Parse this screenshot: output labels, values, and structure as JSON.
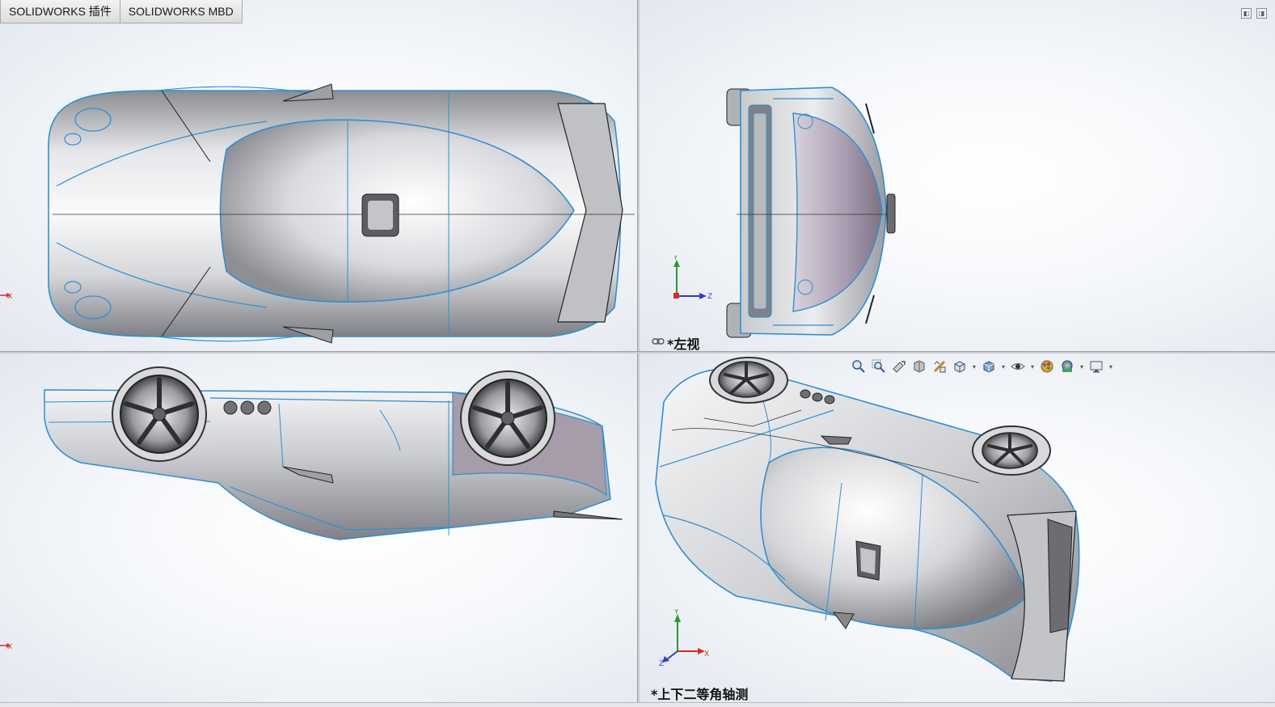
{
  "tabs": [
    {
      "label": "SOLIDWORKS 插件"
    },
    {
      "label": "SOLIDWORKS MBD"
    }
  ],
  "viewports": {
    "top_left": {
      "axis_x": "X"
    },
    "top_right": {
      "view_label": "*左视",
      "axis_y": "Y",
      "axis_z": "Z"
    },
    "bottom_left": {
      "axis_x": "X"
    },
    "bottom_right": {
      "view_label": "*上下二等角轴测",
      "axis_y": "Y",
      "axis_x": "X",
      "axis_z": "Z"
    }
  },
  "heads_up_toolbar": [
    {
      "icon": "zoom-to-fit-icon"
    },
    {
      "icon": "zoom-to-area-icon"
    },
    {
      "icon": "previous-view-icon"
    },
    {
      "icon": "section-view-icon"
    },
    {
      "icon": "dynamic-annotation-icon"
    },
    {
      "icon": "view-orientation-icon",
      "dropdown": true
    },
    {
      "icon": "display-style-icon",
      "dropdown": true
    },
    {
      "icon": "hide-show-items-icon",
      "dropdown": true
    },
    {
      "icon": "edit-appearance-icon"
    },
    {
      "icon": "apply-scene-icon",
      "dropdown": true
    },
    {
      "icon": "view-settings-icon",
      "dropdown": true
    }
  ],
  "colors": {
    "edge_blue": "#2f8fd0",
    "axis_red": "#d42a2a",
    "axis_green": "#2a9a2a",
    "axis_blue": "#2d3fcf",
    "body_gray": "#c6c8cc"
  }
}
